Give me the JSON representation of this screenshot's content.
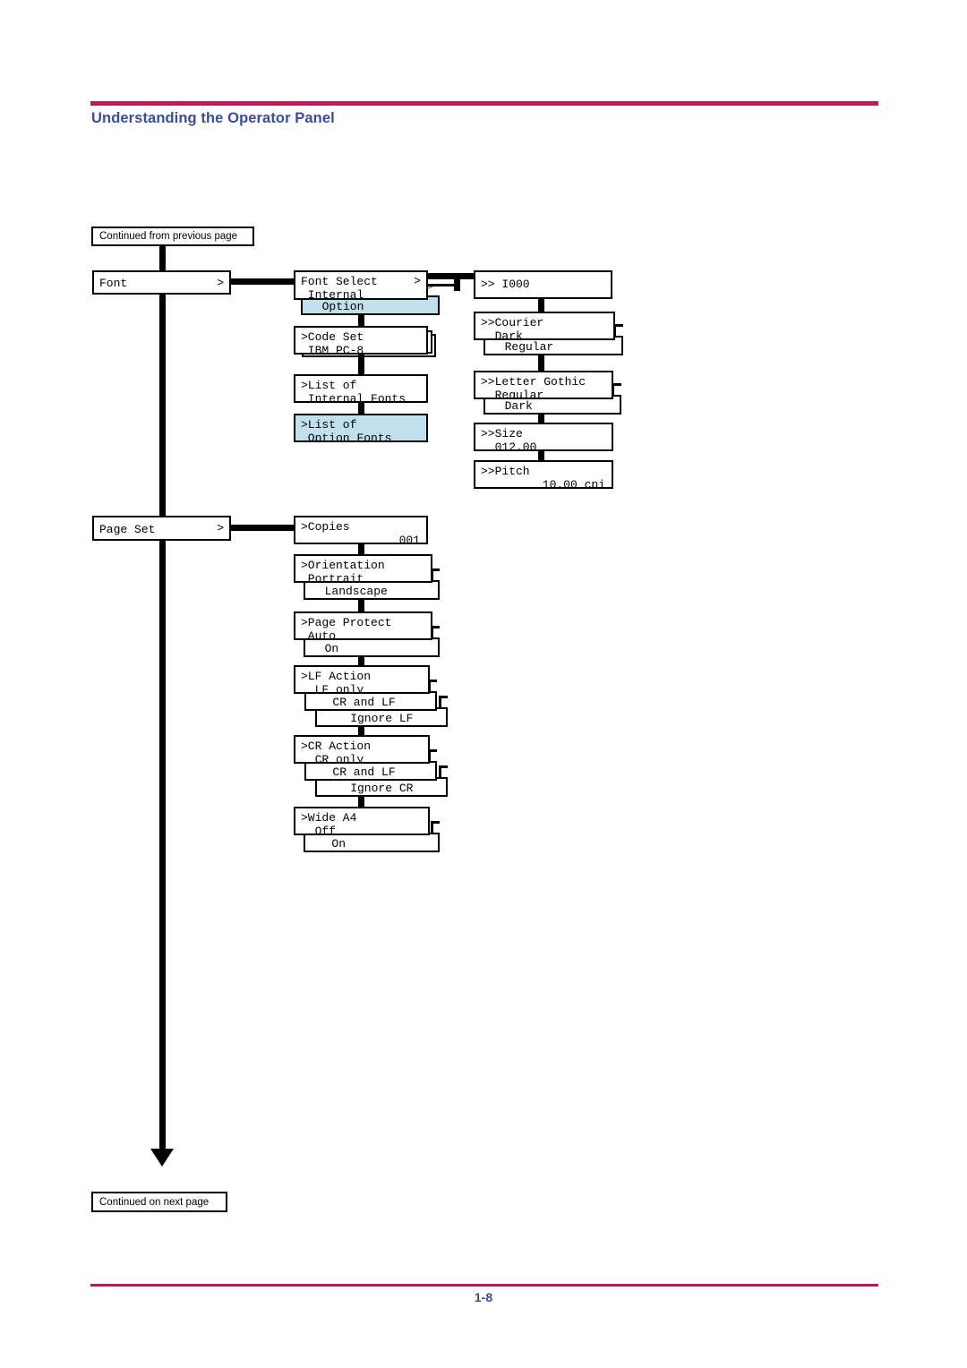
{
  "document": {
    "header_title": "Understanding the Operator Panel",
    "page_number": "1-8",
    "accent_color": "#c2185b",
    "title_color": "#3b4c9a",
    "highlight_color": "#bfe0ec"
  },
  "flow": {
    "continued_from": "Continued from previous page",
    "continued_to": "Continued on next page"
  },
  "menus": {
    "font": {
      "label": "Font",
      "caret": ">"
    },
    "page_set": {
      "label": "Page Set",
      "caret": ">"
    }
  },
  "font_column": [
    {
      "line1": "Font Select",
      "line2": " Internal",
      "caret": ">",
      "sub": {
        "line1": "  Option",
        "caret": ">",
        "highlight": true
      }
    },
    {
      "line1": ">Code Set",
      "line2": " IBM PC-8",
      "stacked": true
    },
    {
      "line1": ">List of",
      "line2": " Internal Fonts"
    },
    {
      "line1": ">List of",
      "line2": " Option Fonts",
      "highlight": true
    }
  ],
  "font_detail_column": [
    {
      "line1": ">> I000"
    },
    {
      "line1": ">>Courier",
      "line2": "  Dark",
      "sub": {
        "line1": "  Regular"
      }
    },
    {
      "line1": ">>Letter Gothic",
      "line2": "  Regular",
      "sub": {
        "line1": "  Dark"
      }
    },
    {
      "line1": ">>Size",
      "line2": "  012.00"
    },
    {
      "line1": ">>Pitch",
      "line2_right": "10.00 cpi"
    }
  ],
  "page_set_column": [
    {
      "line1": ">Copies",
      "line2_right": "001"
    },
    {
      "line1": ">Orientation",
      "line2": " Portrait",
      "sub": {
        "line1": "  Landscape"
      }
    },
    {
      "line1": ">Page Protect",
      "line2": " Auto",
      "sub": {
        "line1": "  On"
      }
    },
    {
      "line1": ">LF Action",
      "line2": "  LF only",
      "sub": {
        "line1": "   CR and LF"
      },
      "sub2": {
        "line1": "    Ignore LF"
      }
    },
    {
      "line1": ">CR Action",
      "line2": "  CR only",
      "sub": {
        "line1": "   CR and LF"
      },
      "sub2": {
        "line1": "    Ignore CR"
      }
    },
    {
      "line1": ">Wide A4",
      "line2": "  Off",
      "sub": {
        "line1": "   On"
      }
    }
  ]
}
